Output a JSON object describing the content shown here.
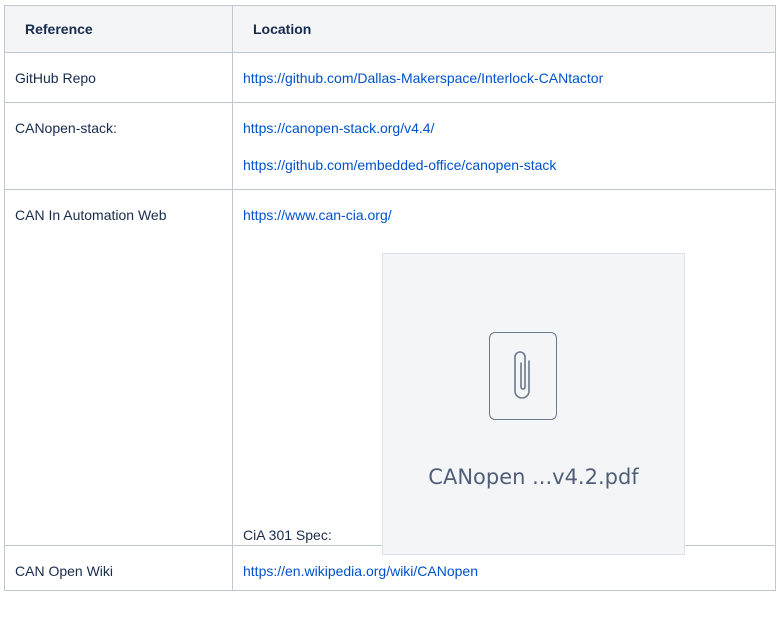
{
  "table": {
    "headers": [
      "Reference",
      "Location"
    ],
    "rows": [
      {
        "reference": "GitHub Repo",
        "links": [
          "https://github.com/Dallas-Makerspace/Interlock-CANtactor"
        ]
      },
      {
        "reference": "CANopen-stack:",
        "links": [
          "https://canopen-stack.org/v4.4/",
          "https://github.com/embedded-office/canopen-stack"
        ]
      },
      {
        "reference": "CAN In Automation Web",
        "links": [
          "https://www.can-cia.org/"
        ],
        "attachment": {
          "label": "CiA 301 Spec:",
          "file_name": "CANopen ...v4.2.pdf",
          "icon": "paperclip-icon"
        }
      },
      {
        "reference": "CAN Open Wiki",
        "links": [
          "https://en.wikipedia.org/wiki/CANopen"
        ]
      }
    ]
  },
  "colors": {
    "link": "#0052cc",
    "header_bg": "#f4f5f7",
    "border": "#c1c7d0",
    "text": "#172b4d"
  }
}
